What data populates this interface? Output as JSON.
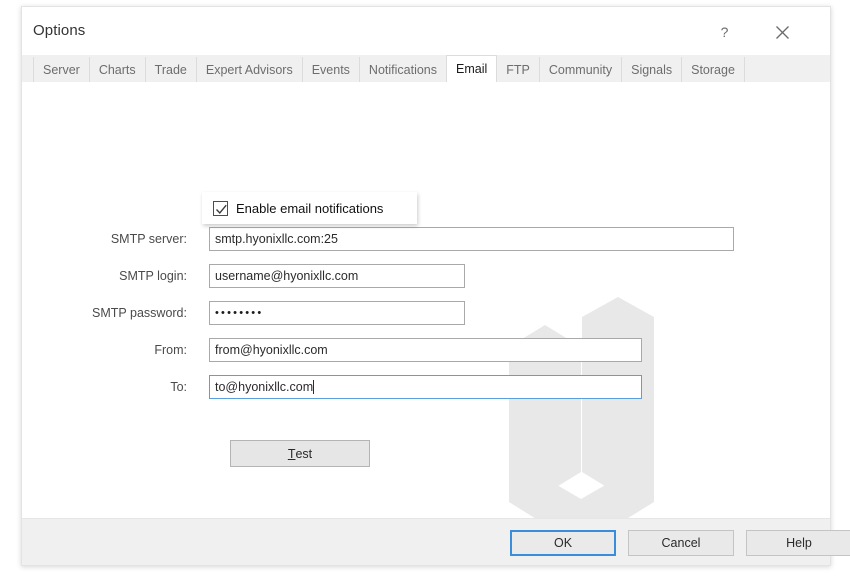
{
  "window": {
    "title": "Options",
    "help_icon": "question-mark-icon",
    "close_icon": "close-x-icon"
  },
  "tabs": [
    {
      "label": "Server",
      "active": false
    },
    {
      "label": "Charts",
      "active": false
    },
    {
      "label": "Trade",
      "active": false
    },
    {
      "label": "Expert Advisors",
      "active": false
    },
    {
      "label": "Events",
      "active": false
    },
    {
      "label": "Notifications",
      "active": false
    },
    {
      "label": "Email",
      "active": true
    },
    {
      "label": "FTP",
      "active": false
    },
    {
      "label": "Community",
      "active": false
    },
    {
      "label": "Signals",
      "active": false
    },
    {
      "label": "Storage",
      "active": false
    }
  ],
  "email_panel": {
    "enable_checkbox": {
      "label": "Enable email notifications",
      "checked": true,
      "check_icon": "checkmark-icon"
    },
    "fields": [
      {
        "label": "SMTP server:",
        "value": "smtp.hyonixllc.com:25",
        "focused": false,
        "masked": false
      },
      {
        "label": "SMTP login:",
        "value": "username@hyonixllc.com",
        "focused": false,
        "masked": false
      },
      {
        "label": "SMTP password:",
        "value": "••••••••",
        "focused": false,
        "masked": true
      },
      {
        "label": "From:",
        "value": "from@hyonixllc.com",
        "focused": false,
        "masked": false
      },
      {
        "label": "To:",
        "value": "to@hyonixllc.com",
        "focused": true,
        "masked": false
      }
    ],
    "test_button": {
      "accelerator": "T",
      "rest": "est"
    },
    "watermark_icon": "u-shield-logo-watermark"
  },
  "footer": {
    "ok_label": "OK",
    "cancel_label": "Cancel",
    "help_label": "Help"
  },
  "colors": {
    "focus_blue": "#3a8ddb",
    "field_border": "#a9a9a9",
    "tab_strip_bg": "#f0f0f0",
    "watermark_gray": "#e8e8e8"
  }
}
